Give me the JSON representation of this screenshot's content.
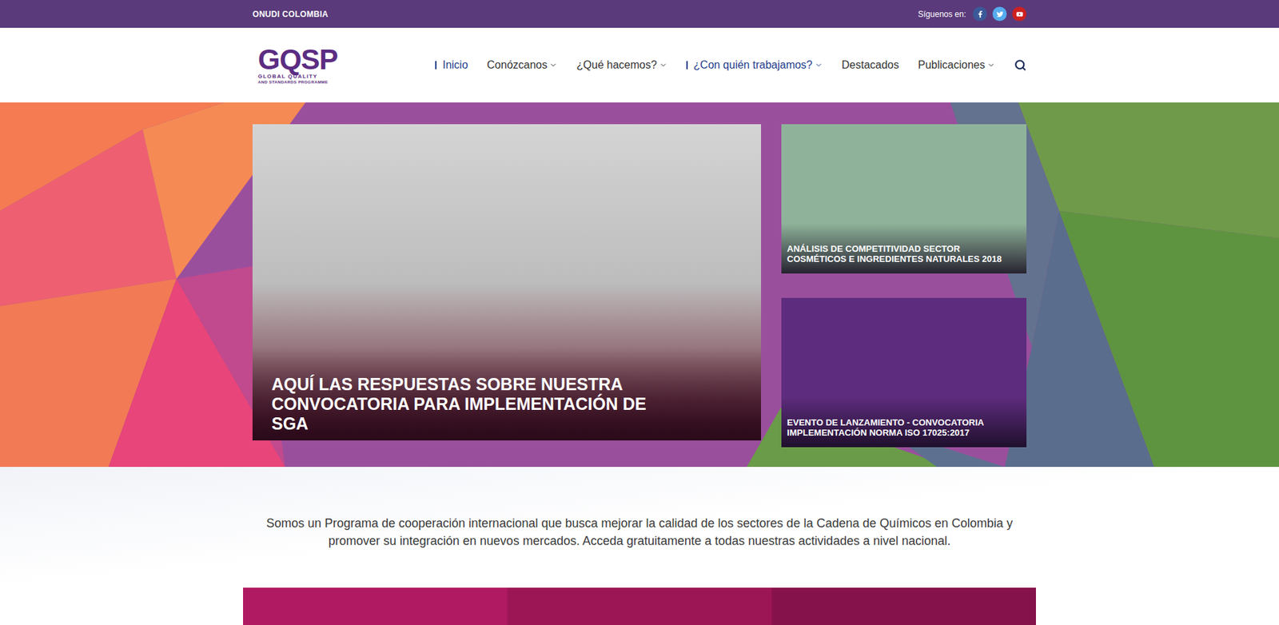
{
  "top_bar": {
    "org": "ONUDI COLOMBIA",
    "follow_label": "Síguenos en:",
    "social": [
      {
        "kind": "facebook",
        "color": "#3b5998"
      },
      {
        "kind": "twitter",
        "color": "#55acee"
      },
      {
        "kind": "youtube",
        "color": "#cd201f"
      }
    ]
  },
  "logo": {
    "mark": "GQSP",
    "line1": "GLOBAL QUALITY",
    "line2": "AND STANDARDS PROGRAMME"
  },
  "nav": [
    {
      "label": "Inicio",
      "dropdown": false,
      "highlighted": true
    },
    {
      "label": "Conózcanos",
      "dropdown": true,
      "highlighted": false
    },
    {
      "label": "¿Qué hacemos?",
      "dropdown": true,
      "highlighted": false
    },
    {
      "label": "¿Con quién trabajamos?",
      "dropdown": true,
      "highlighted": true
    },
    {
      "label": "Destacados",
      "dropdown": false,
      "highlighted": false
    },
    {
      "label": "Publicaciones",
      "dropdown": true,
      "highlighted": false
    }
  ],
  "hero": {
    "main": {
      "caption": "AQUÍ LAS RESPUESTAS SOBRE NUESTRA CONVOCATORIA PARA IMPLEMENTACIÓN DE SGA"
    },
    "side": [
      {
        "caption": "ANÁLISIS DE COMPETITIVIDAD SECTOR COSMÉTICOS E INGREDIENTES NATURALES 2018",
        "color": "#8fb39a"
      },
      {
        "caption": "EVENTO DE LANZAMIENTO - CONVOCATORIA IMPLEMENTACIÓN NORMA ISO 17025:2017",
        "color": "#5e2c7e"
      }
    ]
  },
  "intro": "Somos un Programa de cooperación internacional que busca mejorar la calidad de los sectores de la Cadena de Químicos en Colombia y promover su integración en nuevos mercados. Acceda gratuitamente a todas nuestras actividades a nivel nacional.",
  "tiles": [
    {
      "color": "#b01a62"
    },
    {
      "color": "#9c1656"
    },
    {
      "color": "#86124c"
    }
  ]
}
